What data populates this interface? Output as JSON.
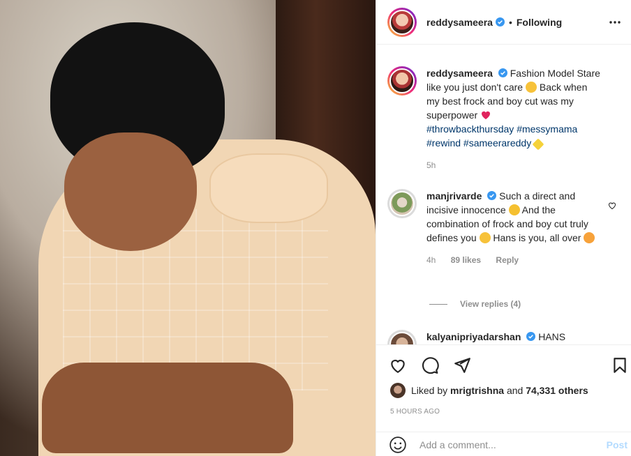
{
  "header": {
    "username": "reddysameera",
    "separator": "•",
    "follow_status": "Following"
  },
  "caption": {
    "username": "reddysameera",
    "text_a": "Fashion Model Stare like you just don't care",
    "text_b": "Back when my best frock and boy cut was my superpower",
    "hashtags": [
      "#throwbackthursday",
      "#messymama",
      "#rewind",
      "#sameerareddy"
    ],
    "time": "5h"
  },
  "comments": [
    {
      "username": "manjrivarde",
      "text_a": "Such a direct and incisive innocence",
      "text_b": "And the combination of frock and boy cut truly defines you",
      "text_c": "Hans is you, all over",
      "time": "4h",
      "likes": "89 likes",
      "reply_label": "Reply",
      "view_replies": "View replies (4)"
    },
    {
      "username": "kalyanipriyadarshan",
      "text_a": "HANS"
    }
  ],
  "actions": {
    "liked_prefix": "Liked by",
    "liked_user": "mrigtrishna",
    "liked_and": "and",
    "liked_count": "74,331 others",
    "timestamp": "5 HOURS AGO"
  },
  "comment_input": {
    "placeholder": "Add a comment...",
    "post_label": "Post"
  },
  "colors": {
    "hashtag": "#00376b",
    "verified": "#3897f0",
    "post_button": "#b3dbff",
    "heart_emoji": "#e0245e"
  },
  "icons": [
    "verified-icon",
    "more-options-icon",
    "like-icon",
    "comment-icon",
    "share-icon",
    "save-icon",
    "emoji-icon"
  ]
}
